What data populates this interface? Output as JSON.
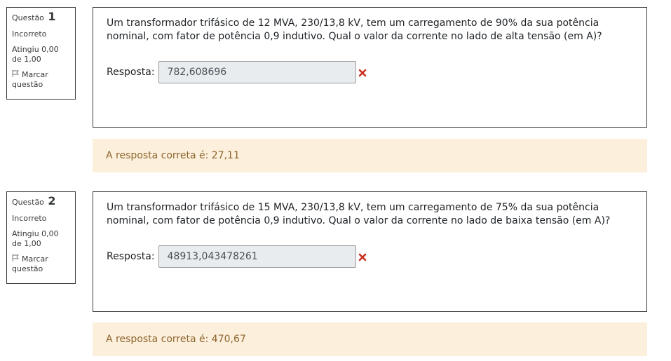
{
  "questions": [
    {
      "label": "Questão",
      "number": "1",
      "state": "Incorreto",
      "grade": "Atingiu 0,00 de 1,00",
      "flag_label": "Marcar questão",
      "text": "Um transformador trifásico de 12 MVA, 230/13,8 kV, tem um carregamento de 90% da sua potência nominal, com fator de potência 0,9 indutivo. Qual o valor da corrente no lado de alta tensão (em A)?",
      "answer_label": "Resposta:",
      "answer_value": "782,608696",
      "feedback": "A resposta correta é: 27,11"
    },
    {
      "label": "Questão",
      "number": "2",
      "state": "Incorreto",
      "grade": "Atingiu 0,00 de 1,00",
      "flag_label": "Marcar questão",
      "text": "Um transformador trifásico de 15 MVA, 230/13,8 kV, tem um carregamento de 75% da sua potência nominal, com fator de potência 0,9 indutivo. Qual o valor da corrente no lado de baixa tensão (em A)?",
      "answer_label": "Resposta:",
      "answer_value": "48913,043478261",
      "feedback": "A resposta correta é: 470,67"
    }
  ],
  "colors": {
    "incorrect_icon": "#ca3120",
    "feedback_bg": "#fcefdc",
    "feedback_text": "#8e662e",
    "input_bg": "#e9ecef"
  }
}
